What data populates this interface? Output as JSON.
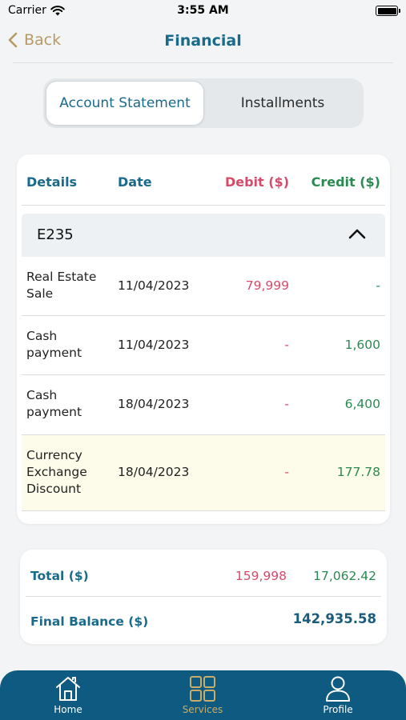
{
  "status_bar": {
    "carrier": "Carrier",
    "time": "3:55 AM"
  },
  "nav": {
    "back_label": "Back",
    "title": "Financial"
  },
  "segments": [
    {
      "label": "Account Statement",
      "active": true
    },
    {
      "label": "Installments",
      "active": false
    }
  ],
  "table": {
    "headers": {
      "details": "Details",
      "date": "Date",
      "debit": "Debit ($)",
      "credit": "Credit ($)"
    },
    "group": {
      "label": "E235",
      "expanded": true
    },
    "rows": [
      {
        "details": "Real Estate Sale",
        "date": "11/04/2023",
        "debit": "79,999",
        "credit": "-"
      },
      {
        "details": "Cash payment",
        "date": "11/04/2023",
        "debit": "-",
        "credit": "1,600"
      },
      {
        "details": "Cash payment",
        "date": "18/04/2023",
        "debit": "-",
        "credit": "6,400"
      },
      {
        "details": "Currency Exchange Discount",
        "date": "18/04/2023",
        "debit": "-",
        "credit": "177.78"
      }
    ]
  },
  "totals": {
    "total_label": "Total ($)",
    "total_debit": "159,998",
    "total_credit": "17,062.42",
    "final_label": "Final Balance ($)",
    "final_balance": "142,935.58"
  },
  "tabbar": {
    "items": [
      {
        "label": "Home",
        "icon": "home-icon",
        "active": false
      },
      {
        "label": "Services",
        "icon": "grid-icon",
        "active": true
      },
      {
        "label": "Profile",
        "icon": "person-icon",
        "active": false
      }
    ]
  },
  "colors": {
    "primary": "#1a6a8c",
    "accent_gold": "#b69a63",
    "debit_red": "#d64b6a",
    "credit_green": "#2a8a52",
    "tabbar_bg": "#0f5a80",
    "highlight_row": "#fdfbea"
  }
}
